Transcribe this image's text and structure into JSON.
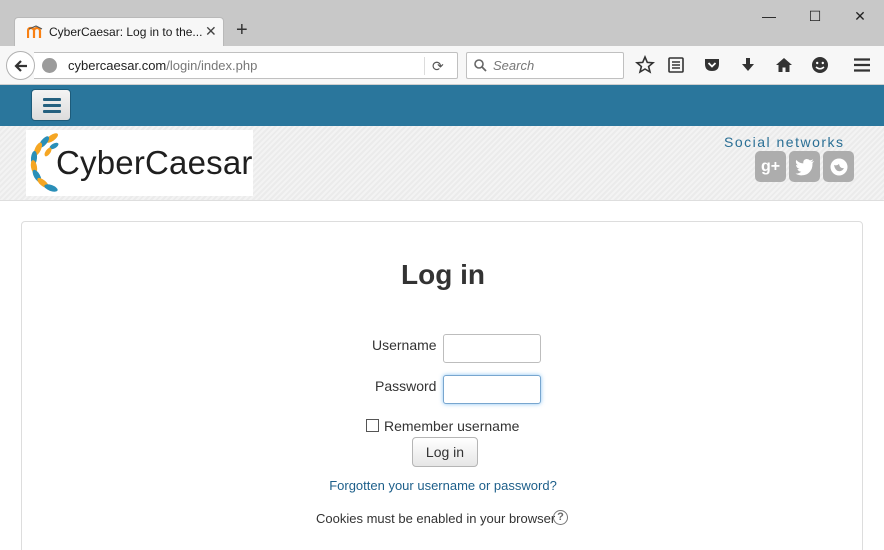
{
  "browser": {
    "tab_title": "CyberCaesar: Log in to the...",
    "tab_close": "✕",
    "new_tab": "+",
    "window": {
      "minimize": "—",
      "maximize": "☐",
      "close": "✕"
    },
    "url_domain": "cybercaesar.com",
    "url_path": "/login/index.php",
    "search_placeholder": "Search"
  },
  "site": {
    "logo_text": "CyberCaesar",
    "social_label": "Social networks",
    "social": [
      {
        "name": "google-plus",
        "glyph": "g+"
      },
      {
        "name": "twitter",
        "glyph": "t"
      },
      {
        "name": "other",
        "glyph": "◉"
      }
    ]
  },
  "login": {
    "title": "Log in",
    "username_label": "Username",
    "username_value": "",
    "password_label": "Password",
    "password_value": "",
    "remember_label": "Remember username",
    "remember_checked": false,
    "submit_label": "Log in",
    "forgot_link": "Forgotten your username or password?",
    "cookies_notice": "Cookies must be enabled in your browser",
    "help_glyph": "?"
  },
  "colors": {
    "accent": "#2a769c",
    "link": "#1d5f8a"
  }
}
